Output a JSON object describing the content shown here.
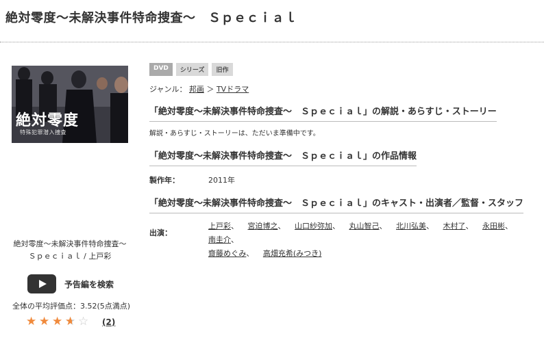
{
  "title": "絶対零度〜未解決事件特命捜査〜　Ｓｐｅｃｉａｌ",
  "poster": {
    "title_text": "絶対零度",
    "subtitle_text": "特殊犯罪潜入捜査"
  },
  "left": {
    "caption_line1": "絶対零度〜未解決事件特命捜査〜",
    "caption_line2": "Ｓｐｅｃｉａｌ / 上戸彩",
    "trailer_label": "予告編を検索",
    "average_text": "全体の平均評価点：3.52(5点満点)",
    "rating": 3.52,
    "review_count": "(2)"
  },
  "tags": [
    "DVD",
    "シリーズ",
    "旧作"
  ],
  "genre": {
    "label": "ジャンル：",
    "crumb1": "邦画",
    "sep": "＞",
    "crumb2": "TVドラマ"
  },
  "sections": {
    "synopsis_heading": "「絶対零度〜未解決事件特命捜査〜　Ｓｐｅｃｉａｌ」の解説・あらすじ・ストーリー",
    "synopsis_text": "解説・あらすじ・ストーリーは、ただいま準備中です。",
    "info_heading": "「絶対零度〜未解決事件特命捜査〜　Ｓｐｅｃｉａｌ」の作品情報",
    "year_label": "製作年：",
    "year_value": "2011年",
    "cast_heading": "「絶対零度〜未解決事件特命捜査〜　Ｓｐｅｃｉａｌ」のキャスト・出演者／監督・スタッフ",
    "cast_label": "出演："
  },
  "cast": [
    "上戸彩",
    "宮迫博之",
    "山口紗弥加",
    "丸山智己",
    "北川弘美",
    "木村了",
    "永田彬",
    "南圭介",
    "齋藤めぐみ",
    "高畑充希(みつき)"
  ],
  "colors": {
    "star": "#f08a3c",
    "star_empty": "#c8c8c8",
    "tag": "#aaaaaa"
  }
}
